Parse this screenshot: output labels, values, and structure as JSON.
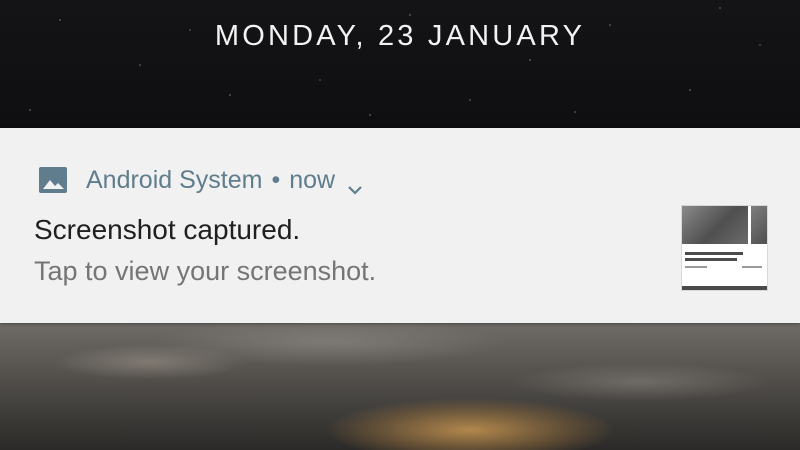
{
  "lockscreen": {
    "date": "MONDAY, 23 JANUARY"
  },
  "notification": {
    "app_icon": "image-icon",
    "app_name": "Android System",
    "separator": "•",
    "time": "now",
    "expand_icon": "chevron-down-icon",
    "title": "Screenshot captured.",
    "text": "Tap to view your screenshot.",
    "thumbnail_icon": "screenshot-thumbnail"
  },
  "colors": {
    "notification_background": "#f1f1f1",
    "app_header": "#5f7d8c",
    "title": "#202020",
    "body_text": "#757575",
    "date_text": "#f2f2f2"
  }
}
